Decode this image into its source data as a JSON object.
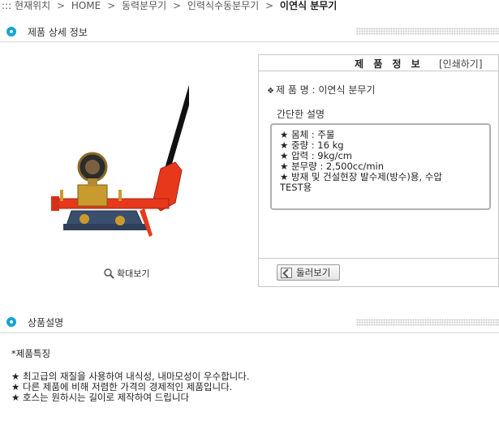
{
  "breadcrumb": {
    "prefix": "::: 현재위치",
    "items": [
      "HOME",
      "동력분무기",
      "인력식수동분무기"
    ],
    "current": "이연식 분무기",
    "separator": ">"
  },
  "sections": {
    "detail_title": "제품 상세 정보",
    "description_title": "상품설명"
  },
  "image": {
    "zoom_label": "확대보기"
  },
  "info": {
    "header_title": "제 품 정 보",
    "print_label": "[인쇄하기]",
    "product_name_label": "제 품 명 : 이연식 분무기",
    "short_desc_title": "간단한 설명",
    "specs": [
      "★ 몸체 : 주물",
      "★ 중량 : 16 kg",
      "★ 압력 : 9kg/cm",
      "★ 분무량 : 2,500cc/min",
      "★ 방재 및 건설현장 발수제(방수)용, 수압",
      "TEST용"
    ],
    "browse_label": "둘러보기"
  },
  "features": {
    "title": "*제품특징",
    "lines": [
      "★ 최고급의 재질을 사용하여 내식성, 내마모성이 우수합니다.",
      "★ 다른 제품에 비해 저렴한 가격의 경제적인 제품입니다.",
      "★ 호스는 원하시는 길이로 제작하여 드립니다"
    ]
  },
  "colors": {
    "accent": "#14a2d8",
    "pump_body": "#e8381c",
    "brass": "#c99a2e"
  }
}
